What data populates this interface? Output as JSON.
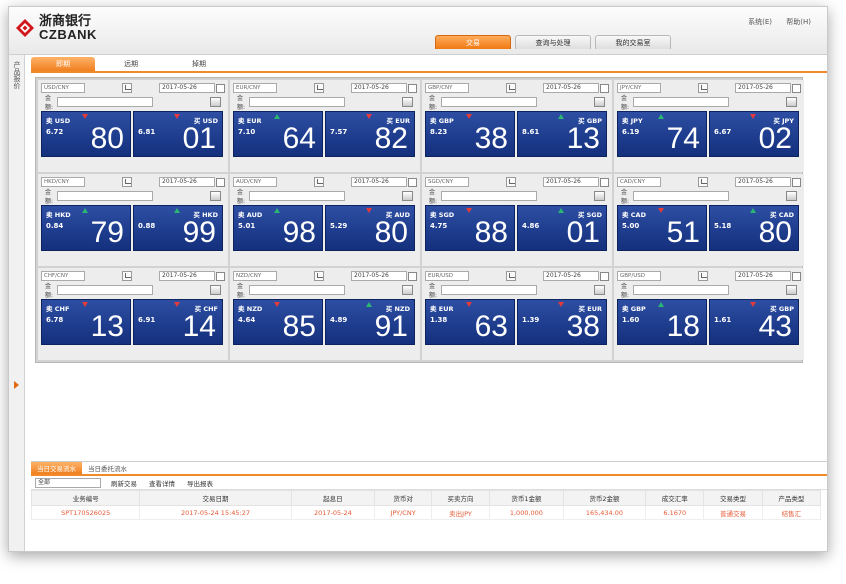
{
  "app": {
    "logo_cn": "浙商银行",
    "logo_en": "CZBANK"
  },
  "toplinks": [
    "系统(E)",
    "帮助(H)"
  ],
  "maintabs": [
    {
      "label": "交易",
      "active": true
    },
    {
      "label": "查询与处理",
      "active": false
    },
    {
      "label": "我的交易室",
      "active": false
    }
  ],
  "left_strip_label": "产品报价",
  "subtabs": [
    {
      "label": "即期",
      "active": true
    },
    {
      "label": "远期",
      "active": false
    },
    {
      "label": "掉期",
      "active": false
    }
  ],
  "panels": [
    {
      "pair": "USD/CNY",
      "date": "2017-05-26",
      "amount_label": "金额:",
      "sell": {
        "label": "卖 USD",
        "small": "6.72",
        "big": "80",
        "trend": "down"
      },
      "buy": {
        "label": "买 USD",
        "small": "6.81",
        "big": "01",
        "trend": "down"
      }
    },
    {
      "pair": "EUR/CNY",
      "date": "2017-05-26",
      "amount_label": "金额:",
      "sell": {
        "label": "卖 EUR",
        "small": "7.10",
        "big": "64",
        "trend": "up"
      },
      "buy": {
        "label": "买 EUR",
        "small": "7.57",
        "big": "82",
        "trend": "down"
      }
    },
    {
      "pair": "GBP/CNY",
      "date": "2017-05-26",
      "amount_label": "金额:",
      "sell": {
        "label": "卖 GBP",
        "small": "8.23",
        "big": "38",
        "trend": "down"
      },
      "buy": {
        "label": "买 GBP",
        "small": "8.61",
        "big": "13",
        "trend": "up"
      }
    },
    {
      "pair": "JPY/CNY",
      "date": "2017-05-26",
      "amount_label": "金额:",
      "sell": {
        "label": "卖 JPY",
        "small": "6.19",
        "big": "74",
        "trend": "up"
      },
      "buy": {
        "label": "买 JPY",
        "small": "6.67",
        "big": "02",
        "trend": "down"
      }
    },
    {
      "pair": "HKD/CNY",
      "date": "2017-05-26",
      "amount_label": "金额:",
      "sell": {
        "label": "卖 HKD",
        "small": "0.84",
        "big": "79",
        "trend": "up"
      },
      "buy": {
        "label": "买 HKD",
        "small": "0.88",
        "big": "99",
        "trend": "up"
      }
    },
    {
      "pair": "AUD/CNY",
      "date": "2017-05-26",
      "amount_label": "金额:",
      "sell": {
        "label": "卖 AUD",
        "small": "5.01",
        "big": "98",
        "trend": "up"
      },
      "buy": {
        "label": "买 AUD",
        "small": "5.29",
        "big": "80",
        "trend": "down"
      }
    },
    {
      "pair": "SGD/CNY",
      "date": "2017-05-26",
      "amount_label": "金额:",
      "sell": {
        "label": "卖 SGD",
        "small": "4.75",
        "big": "88",
        "trend": "down"
      },
      "buy": {
        "label": "买 SGD",
        "small": "4.86",
        "big": "01",
        "trend": "up"
      }
    },
    {
      "pair": "CAD/CNY",
      "date": "2017-05-26",
      "amount_label": "金额:",
      "sell": {
        "label": "卖 CAD",
        "small": "5.00",
        "big": "51",
        "trend": "down"
      },
      "buy": {
        "label": "买 CAD",
        "small": "5.18",
        "big": "80",
        "trend": "up"
      }
    },
    {
      "pair": "CHF/CNY",
      "date": "2017-05-26",
      "amount_label": "金额:",
      "sell": {
        "label": "卖 CHF",
        "small": "6.78",
        "big": "13",
        "trend": "down"
      },
      "buy": {
        "label": "买 CHF",
        "small": "6.91",
        "big": "14",
        "trend": "down"
      }
    },
    {
      "pair": "NZD/CNY",
      "date": "2017-05-26",
      "amount_label": "金额:",
      "sell": {
        "label": "卖 NZD",
        "small": "4.64",
        "big": "85",
        "trend": "down"
      },
      "buy": {
        "label": "买 NZD",
        "small": "4.89",
        "big": "91",
        "trend": "up"
      }
    },
    {
      "pair": "EUR/USD",
      "date": "2017-05-26",
      "amount_label": "金额:",
      "sell": {
        "label": "卖 EUR",
        "small": "1.38",
        "big": "63",
        "trend": "down"
      },
      "buy": {
        "label": "买 EUR",
        "small": "1.39",
        "big": "38",
        "trend": "down"
      }
    },
    {
      "pair": "GBP/USD",
      "date": "2017-05-26",
      "amount_label": "金额:",
      "sell": {
        "label": "卖 GBP",
        "small": "1.60",
        "big": "18",
        "trend": "up"
      },
      "buy": {
        "label": "买 GBP",
        "small": "1.61",
        "big": "43",
        "trend": "down"
      }
    }
  ],
  "bottom": {
    "tabs": [
      {
        "label": "当日交易流水",
        "active": true
      },
      {
        "label": "当日委托流水",
        "active": false
      }
    ],
    "filter_value": "全部",
    "tools": [
      "刷新交易",
      "查看详情",
      "导出报表"
    ],
    "columns": [
      "业务编号",
      "交易日期",
      "起息日",
      "货币对",
      "买卖方向",
      "货币1金额",
      "货币2金额",
      "成交汇率",
      "交易类型",
      "产品类型"
    ],
    "rows": [
      [
        "SPT170526025",
        "2017-05-24 15:45:27",
        "2017-05-24",
        "JPY/CNY",
        "卖出JPY",
        "1,000,000",
        "165,434.00",
        "6.1670",
        "普通交易",
        "结售汇"
      ]
    ]
  }
}
